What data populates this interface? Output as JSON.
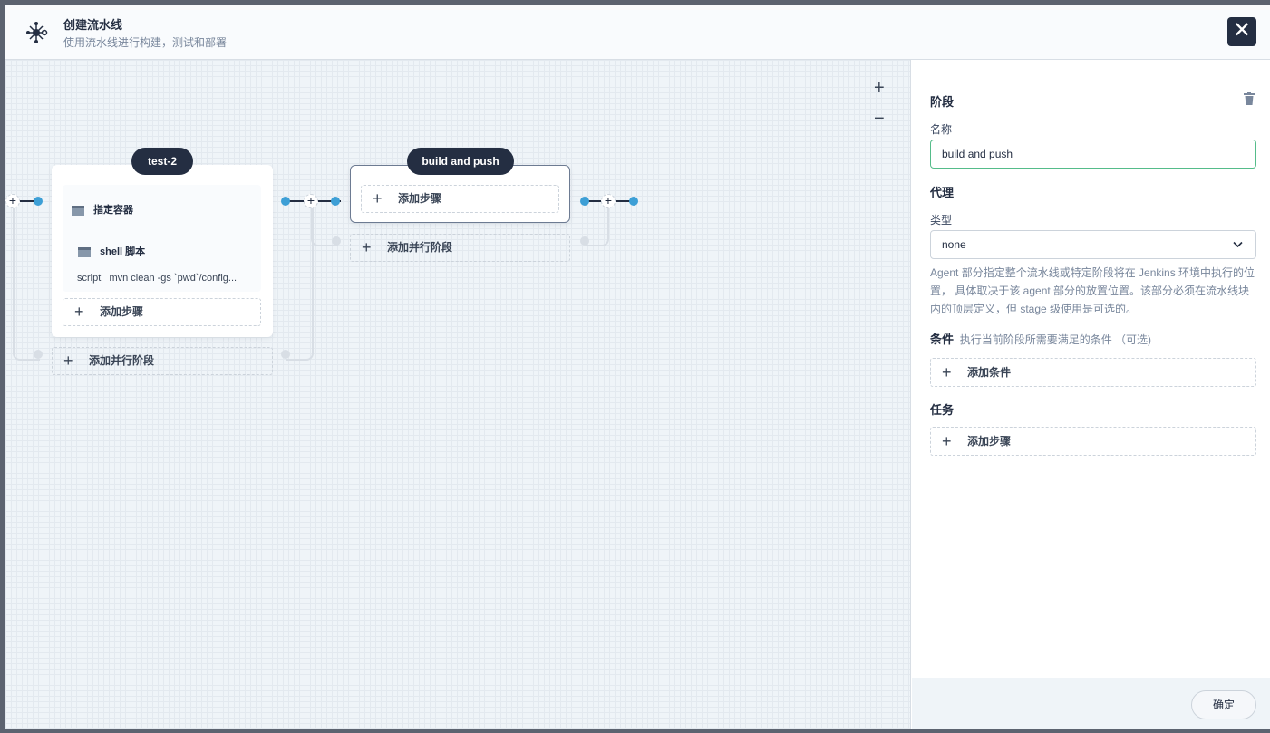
{
  "header": {
    "title": "创建流水线",
    "subtitle": "使用流水线进行构建，测试和部署",
    "close_icon": "close-icon"
  },
  "canvas": {
    "zoom_in": "+",
    "zoom_out": "−",
    "stages": [
      {
        "name": "test-2",
        "steps": [
          {
            "title": "指定容器"
          },
          {
            "title": "shell 脚本",
            "detail_key": "script",
            "detail_value": "mvn clean -gs `pwd`/config..."
          }
        ],
        "add_step": "添加步骤",
        "add_parallel": "添加并行阶段"
      },
      {
        "name": "build and push",
        "steps": [],
        "add_step": "添加步骤",
        "add_parallel": "添加并行阶段"
      }
    ]
  },
  "panel": {
    "section_title": "阶段",
    "name_label": "名称",
    "name_value": "build and push",
    "agent_title": "代理",
    "type_label": "类型",
    "type_value": "none",
    "agent_desc": "Agent 部分指定整个流水线或特定阶段将在 Jenkins 环境中执行的位置， 具体取决于该 agent 部分的放置位置。该部分必须在流水线块内的顶层定义，但 stage 级使用是可选的。",
    "condition_title": "条件",
    "condition_hint": "执行当前阶段所需要满足的条件 （可选)",
    "add_condition": "添加条件",
    "task_title": "任务",
    "add_step": "添加步骤",
    "confirm": "确定"
  },
  "colors": {
    "accent": "#55bc8a",
    "dark": "#242e42",
    "connector": "#3d9fd6"
  }
}
